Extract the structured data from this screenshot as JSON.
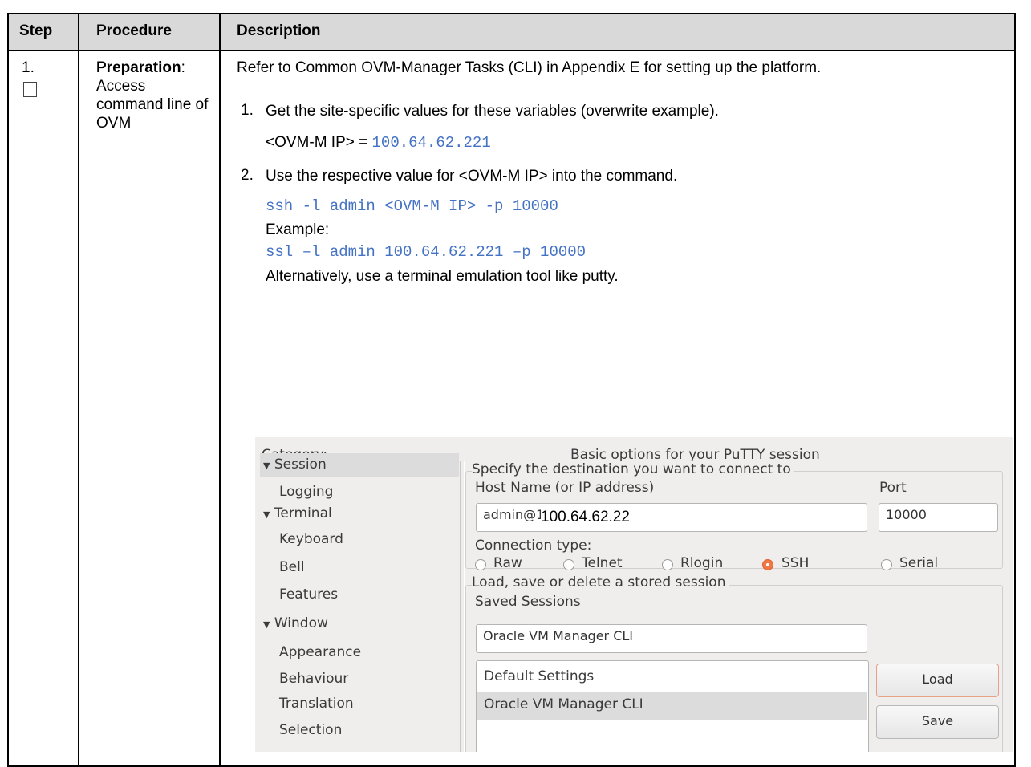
{
  "table": {
    "headers": {
      "step": "Step",
      "procedure": "Procedure",
      "description": "Description"
    },
    "row": {
      "step_number": "1.",
      "procedure_bold": "Preparation",
      "procedure_rest": ": Access command line of OVM",
      "intro": "Refer to Common OVM-Manager Tasks (CLI) in Appendix E for setting up the platform.",
      "item1_num": "1.",
      "item1_text": "Get the site-specific values for these variables (overwrite example).",
      "ip_label": "<OVM-M IP> = ",
      "ip_value": "100.64.62.221",
      "item2_num": "2.",
      "item2_text": "Use the respective value for <OVM-M IP> into the command.",
      "cmd_template": "ssh -l admin <OVM-M IP> -p 10000",
      "example_label": "Example:",
      "cmd_example": "ssl –l admin 100.64.62.221 –p 10000",
      "alternative": "Alternatively, use a terminal emulation tool like putty."
    }
  },
  "putty": {
    "category_label": "Category:",
    "panel_title": "Basic options for your PuTTY session",
    "tree": [
      {
        "label": "Session",
        "expanded": true
      },
      {
        "label": "Logging"
      },
      {
        "label": "Terminal",
        "expanded": true
      },
      {
        "label": "Keyboard"
      },
      {
        "label": "Bell"
      },
      {
        "label": "Features"
      },
      {
        "label": "Window",
        "expanded": true
      },
      {
        "label": "Appearance"
      },
      {
        "label": "Behaviour"
      },
      {
        "label": "Translation"
      },
      {
        "label": "Selection"
      }
    ],
    "destination_group": "Specify the destination you want to connect to",
    "host_label_pre": "Host ",
    "host_label_u": "N",
    "host_label_post": "ame (or IP address)",
    "port_label_u": "P",
    "port_label_post": "ort",
    "host_value_prefix": "admin@1",
    "host_value_overlay": "100.64.62.22",
    "port_value": "10000",
    "connection_type_label": "Connection type:",
    "connection_types": [
      "Raw",
      "Telnet",
      "Rlogin",
      "SSH",
      "Serial"
    ],
    "connection_selected": "SSH",
    "session_group": "Load, save or delete a stored session",
    "saved_sessions_label": "Saved Sessions",
    "saved_session_value": "Oracle VM Manager CLI",
    "session_list": [
      "Default Settings",
      "Oracle VM Manager CLI"
    ],
    "session_list_selected": "Oracle VM Manager CLI",
    "load_button": "Load",
    "save_button": "Save"
  }
}
